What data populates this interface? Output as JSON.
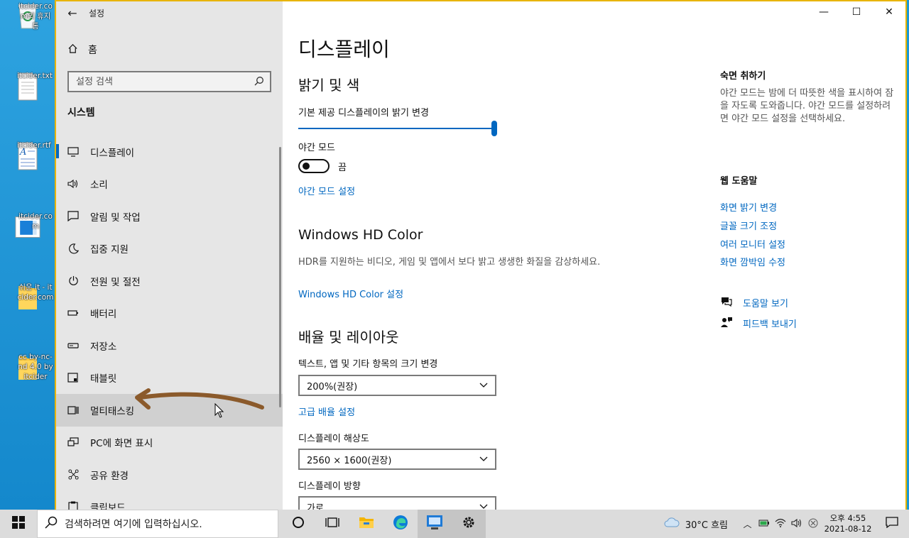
{
  "desktop": {
    "icons": [
      {
        "label": "itcider.com의 휴지통",
        "icon": "recycle-bin-icon"
      },
      {
        "label": "itcider.txt",
        "icon": "text-file-icon"
      },
      {
        "label": "itcider.rtf",
        "icon": "rtf-file-icon"
      },
      {
        "label": "itcider.com",
        "icon": "web-shortcut-icon"
      },
      {
        "label": "쉬운 it - itcider.com",
        "icon": "folder-icon"
      },
      {
        "label": "cc by-nc-nd 4.0 by itcider",
        "icon": "folder-icon"
      }
    ]
  },
  "window": {
    "title": "설정",
    "controls": {
      "minimize": "—",
      "maximize": "☐",
      "close": "✕"
    }
  },
  "sidebar": {
    "home_label": "홈",
    "search_placeholder": "설정 검색",
    "section_title": "시스템",
    "items": [
      {
        "label": "디스플레이",
        "icon": "monitor-icon"
      },
      {
        "label": "소리",
        "icon": "speaker-icon"
      },
      {
        "label": "알림 및 작업",
        "icon": "notification-icon"
      },
      {
        "label": "집중 지원",
        "icon": "moon-icon"
      },
      {
        "label": "전원 및 절전",
        "icon": "power-icon"
      },
      {
        "label": "배터리",
        "icon": "battery-icon"
      },
      {
        "label": "저장소",
        "icon": "storage-icon"
      },
      {
        "label": "태블릿",
        "icon": "tablet-icon"
      },
      {
        "label": "멀티태스킹",
        "icon": "multitasking-icon"
      },
      {
        "label": "PC에 화면 표시",
        "icon": "project-icon"
      },
      {
        "label": "공유 환경",
        "icon": "share-icon"
      },
      {
        "label": "클립보드",
        "icon": "clipboard-icon"
      }
    ]
  },
  "main": {
    "page_title": "디스플레이",
    "brightness": {
      "heading": "밝기 및 색",
      "slider_label": "기본 제공 디스플레이의 밝기 변경",
      "value": 1.0
    },
    "night_mode": {
      "label": "야간 모드",
      "state": "끔",
      "settings_link": "야간 모드 설정"
    },
    "hdr": {
      "heading": "Windows HD Color",
      "description": "HDR를 지원하는 비디오, 게임 및 앱에서 보다 밝고 생생한 화질을 감상하세요.",
      "link": "Windows HD Color 설정"
    },
    "scale_layout": {
      "heading": "배율 및 레이아웃",
      "scale_label": "텍스트, 앱 및 기타 항목의 크기 변경",
      "scale_value": "200%(권장)",
      "advanced_link": "고급 배율 설정",
      "resolution_label": "디스플레이 해상도",
      "resolution_value": "2560 × 1600(권장)",
      "orientation_label": "디스플레이 방향",
      "orientation_value": "가로"
    }
  },
  "right": {
    "sleep_title": "숙면 취하기",
    "sleep_desc": "야간 모드는 밤에 더 따뜻한 색을 표시하여 잠을 자도록 도와줍니다. 야간 모드를 설정하려면 야간 모드 설정을 선택하세요.",
    "web_help_title": "웹 도움말",
    "web_links": [
      "화면 밝기 변경",
      "글꼴 크기 조정",
      "여러 모니터 설정",
      "화면 깜박임 수정"
    ],
    "help_link": "도움말 보기",
    "feedback_link": "피드백 보내기"
  },
  "taskbar": {
    "search_placeholder": "검색하려면 여기에 입력하십시오.",
    "weather": "30°C 흐림",
    "time": "오후 4:55",
    "date": "2021-08-12"
  }
}
